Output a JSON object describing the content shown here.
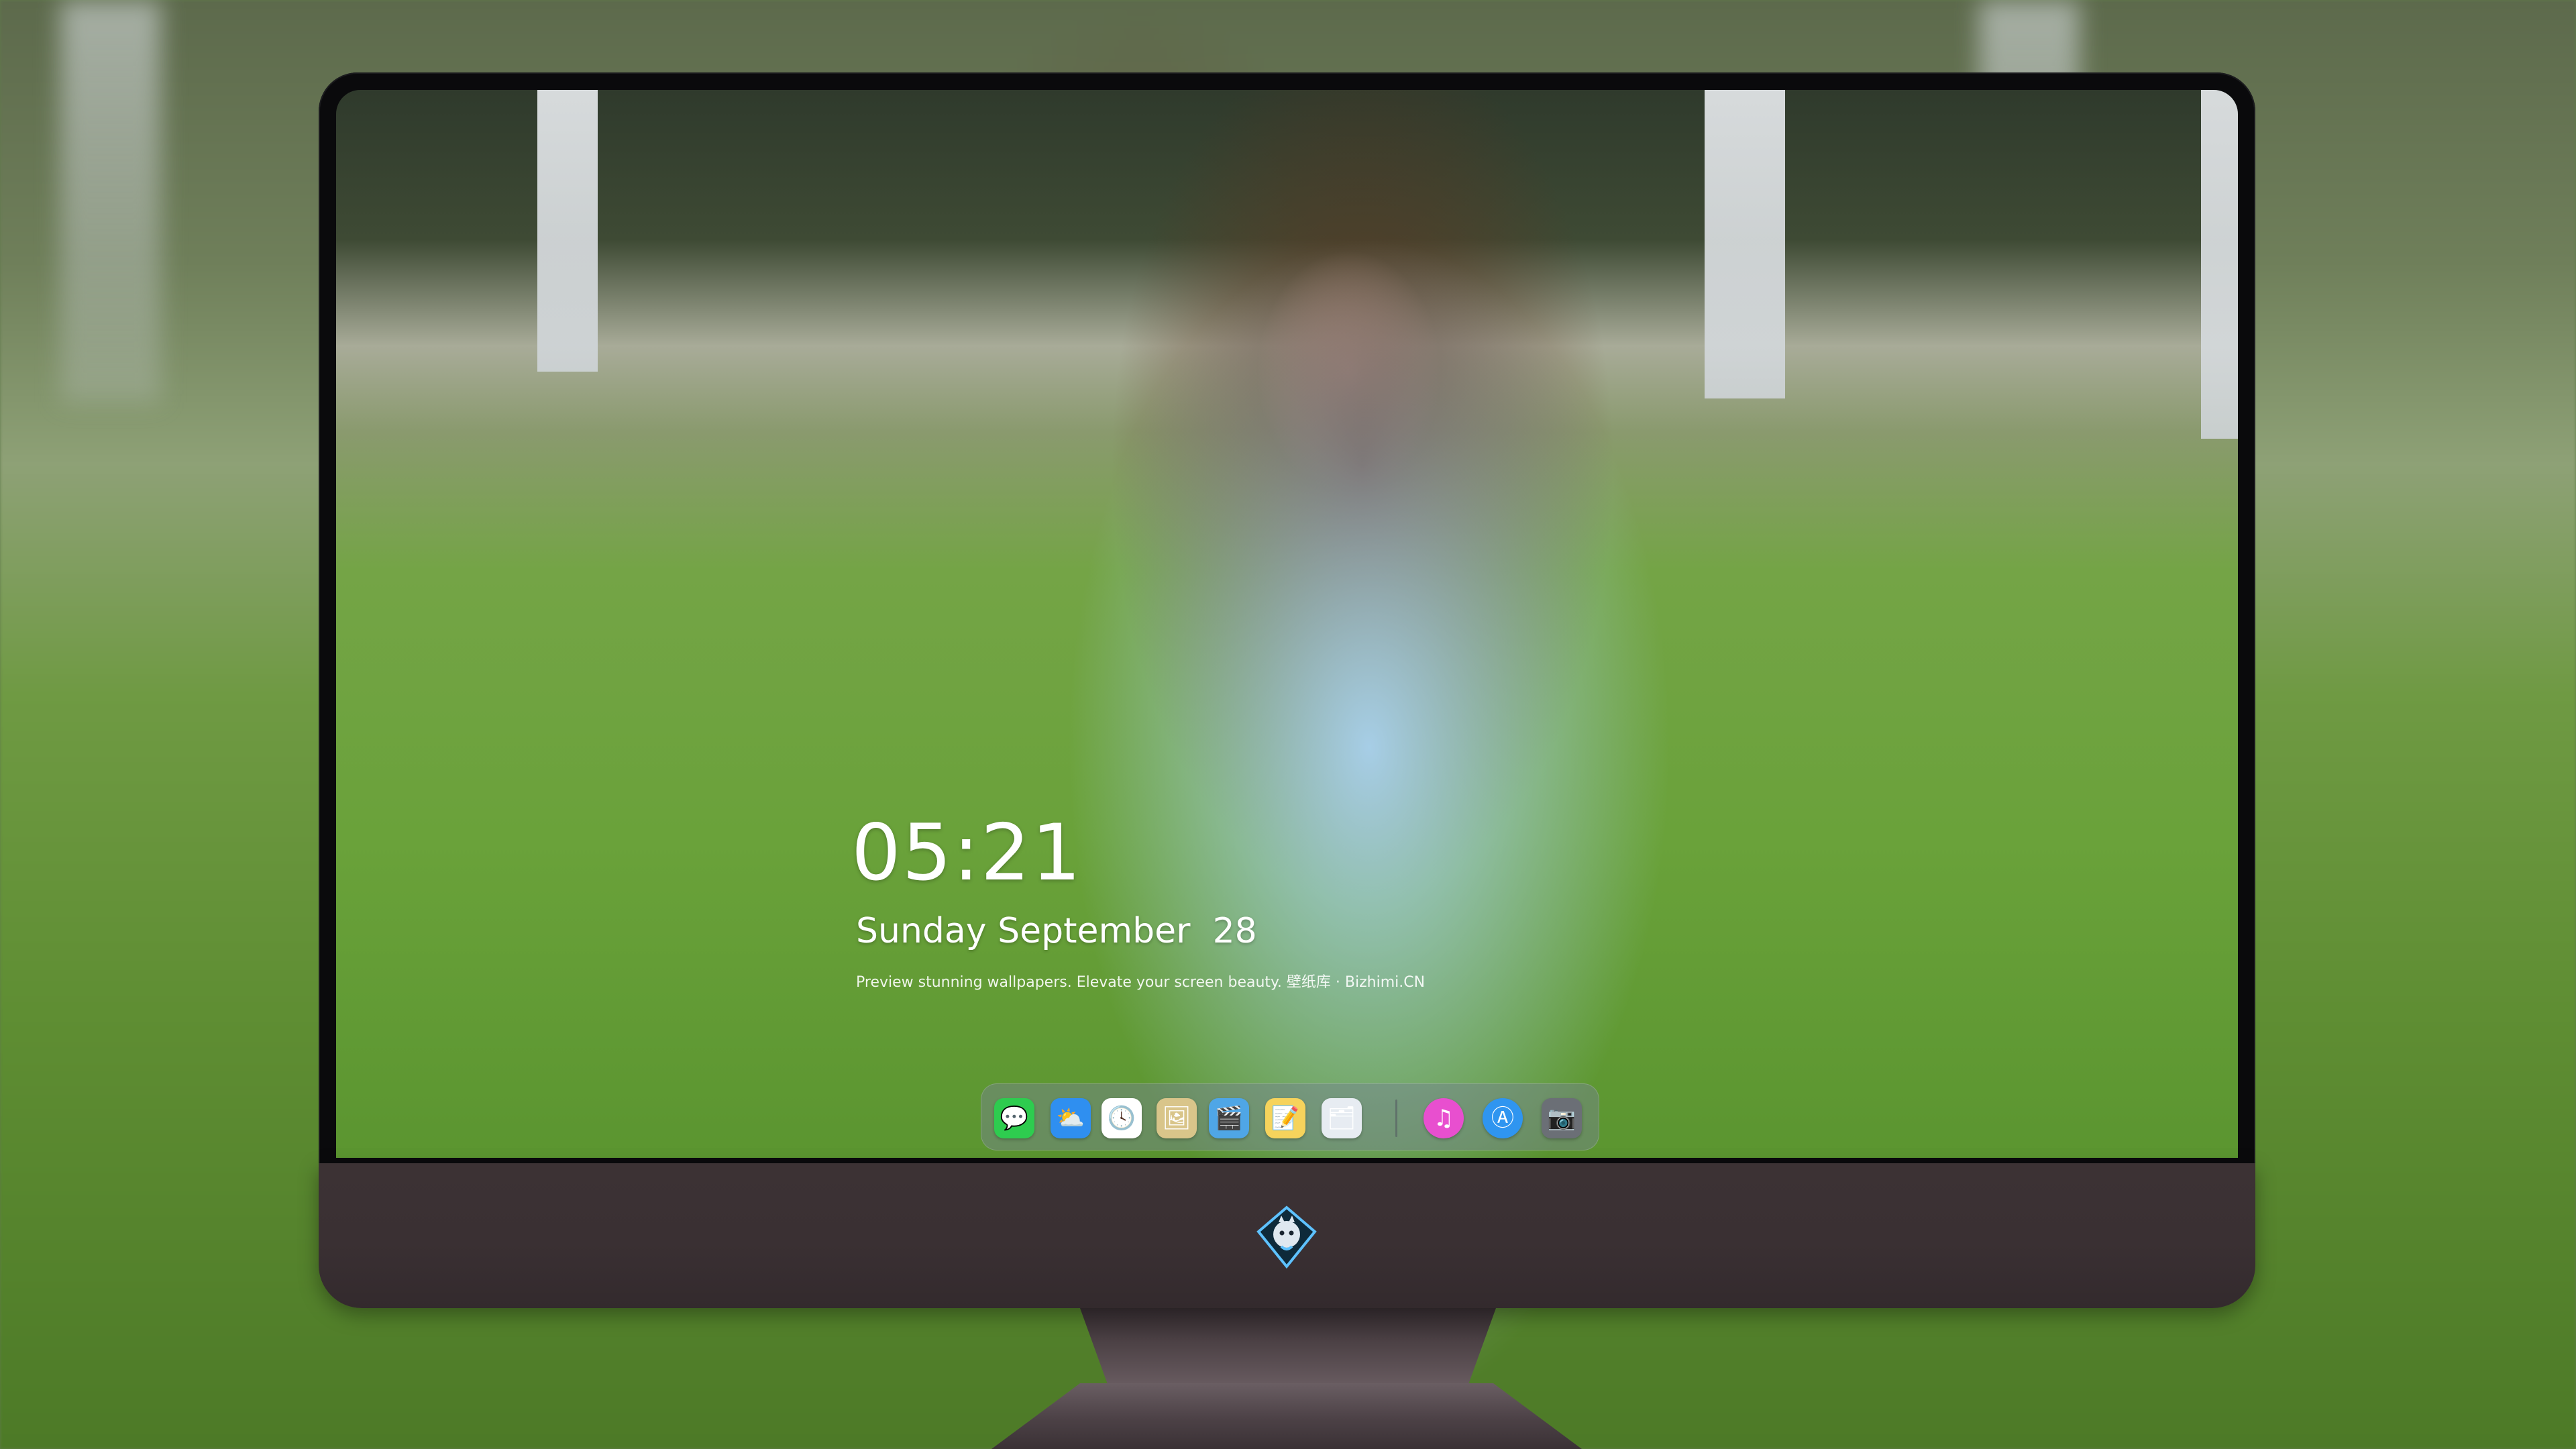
{
  "lockscreen": {
    "time": "05:21",
    "date": "Sunday September  28",
    "tagline": "Preview stunning wallpapers. Elevate your screen beauty.  壁纸库 · Bizhimi.CN"
  },
  "dock": {
    "apps": [
      {
        "name": "Messages",
        "icon": "messages-icon",
        "glyph": "💬",
        "color": "#2ecc4f"
      },
      {
        "name": "Weather",
        "icon": "weather-icon",
        "glyph": "⛅",
        "color": "#2f8ff0"
      },
      {
        "name": "Clock",
        "icon": "clock-icon",
        "glyph": "🕓",
        "color": "#ffffff"
      },
      {
        "name": "Preview",
        "icon": "preview-icon",
        "glyph": "🖼",
        "color": "#d9c58a"
      },
      {
        "name": "Video",
        "icon": "clapperboard-icon",
        "glyph": "🎬",
        "color": "#4fa6e6"
      },
      {
        "name": "Notes",
        "icon": "notes-icon",
        "glyph": "📝",
        "color": "#f6d35c"
      },
      {
        "name": "Photo Library",
        "icon": "photo-library-icon",
        "glyph": "🗂",
        "color": "#e7ecf2"
      },
      {
        "name": "Music",
        "icon": "music-icon",
        "glyph": "♫",
        "color": "#e84fcf"
      },
      {
        "name": "App Store",
        "icon": "app-store-icon",
        "glyph": "Ⓐ",
        "color": "#2f95f0"
      },
      {
        "name": "Camera",
        "icon": "camera-icon",
        "glyph": "📷",
        "color": "#6b6f76"
      }
    ]
  },
  "brand": {
    "logo": "mascot-logo-icon",
    "chin_color": "#3a3033"
  }
}
